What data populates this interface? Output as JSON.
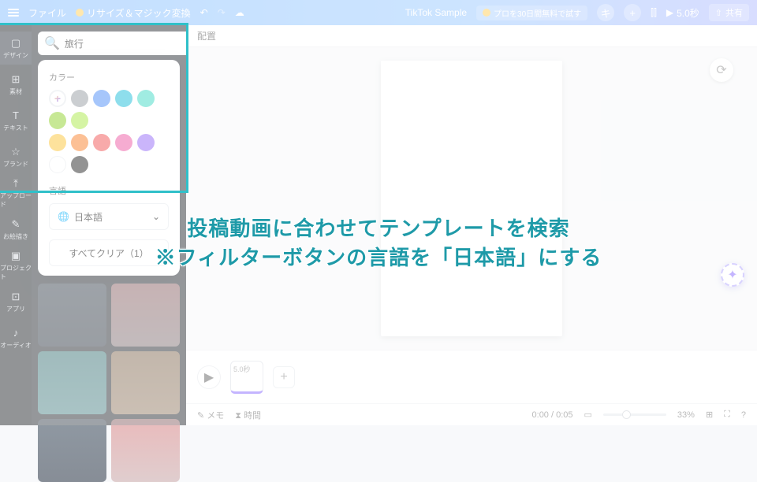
{
  "topbar": {
    "file": "ファイル",
    "resize": "リサイズ＆マジック変換",
    "title": "TikTok Sample",
    "pro": "プロを30日間無料で試す",
    "duration": "5.0秒",
    "share": "共有"
  },
  "rail": {
    "items": [
      {
        "icon": "▢",
        "label": "デザイン"
      },
      {
        "icon": "⊞",
        "label": "素材"
      },
      {
        "icon": "T",
        "label": "テキスト"
      },
      {
        "icon": "☆",
        "label": "ブランド"
      },
      {
        "icon": "⤒",
        "label": "アップロード"
      },
      {
        "icon": "✎",
        "label": "お絵描き"
      },
      {
        "icon": "▣",
        "label": "プロジェクト"
      },
      {
        "icon": "⊡",
        "label": "アプリ"
      },
      {
        "icon": "♪",
        "label": "オーディオ"
      }
    ]
  },
  "search": {
    "placeholder": "",
    "value": "旅行"
  },
  "filter": {
    "badge": "1"
  },
  "popover": {
    "color_label": "カラー",
    "colors_row1": [
      "#8d9399",
      "#3b82f6",
      "#06b6d4",
      "#2dd4bf",
      "#84cc16",
      "#a3e635"
    ],
    "colors_row2": [
      "#fbbf24",
      "#f97316",
      "#ef4444",
      "#ec4899",
      "#8b5cf6",
      "#ffffff",
      "#111111"
    ],
    "lang_label": "言語",
    "lang_value": "日本語",
    "clear_all": "すべてクリア（1）"
  },
  "canvas": {
    "position_label": "配置"
  },
  "timeline": {
    "thumb_duration": "5.0秒"
  },
  "bottombar": {
    "memo": "メモ",
    "time_label": "時間",
    "time": "0:00 / 0:05",
    "zoom": "33%",
    "help": "?"
  },
  "annotation": {
    "line1": "投稿動画に合わせてテンプレートを検索",
    "line2": "※フィルターボタンの言語を「日本語」にする"
  }
}
